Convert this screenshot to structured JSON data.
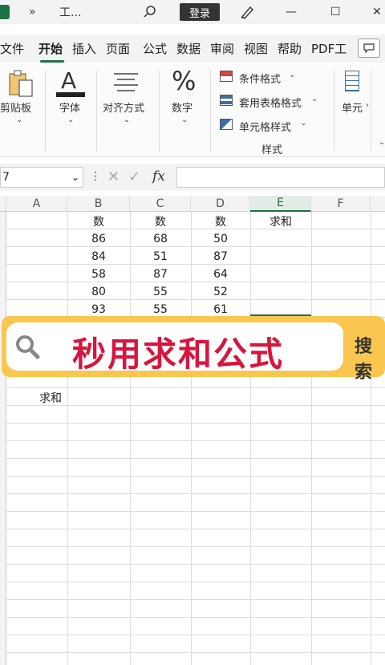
{
  "titlebar": {
    "more": "»",
    "title": "工...",
    "search_icon": "search-icon",
    "login": "登录",
    "pen_icon": "pen-icon",
    "minimize": "—",
    "maximize": "☐",
    "close": "✕"
  },
  "menu": {
    "items": [
      "文件",
      "开始",
      "插入",
      "页面",
      "公式",
      "数据",
      "审阅",
      "视图",
      "帮助",
      "PDF工"
    ],
    "active": "开始",
    "comment_icon": "comment-icon"
  },
  "ribbon": {
    "clipboard": "剪贴板",
    "font": "字体",
    "align": "对齐方式",
    "number": "数字",
    "conditional": "条件格式",
    "table_format": "套用表格格式",
    "cell_style": "单元格样式",
    "styles_group": "样式",
    "cells": "单元"
  },
  "formula_bar": {
    "name_box": "7",
    "fx": "fx",
    "cancel": "✕",
    "confirm": "✓",
    "dots": "⋮"
  },
  "columns": [
    "A",
    "B",
    "C",
    "D",
    "E",
    "F"
  ],
  "cells": {
    "b1": "数",
    "c1": "数",
    "d1": "数",
    "e1": "求和",
    "b2": "86",
    "c2": "68",
    "d2": "50",
    "b3": "84",
    "c3": "51",
    "d3": "87",
    "b4": "58",
    "c4": "87",
    "d4": "64",
    "b5": "80",
    "c5": "55",
    "d5": "52",
    "b6": "93",
    "c6": "55",
    "d6": "61",
    "a10": "求和"
  },
  "banner": {
    "text": "秒用求和公式",
    "button": "搜索"
  }
}
